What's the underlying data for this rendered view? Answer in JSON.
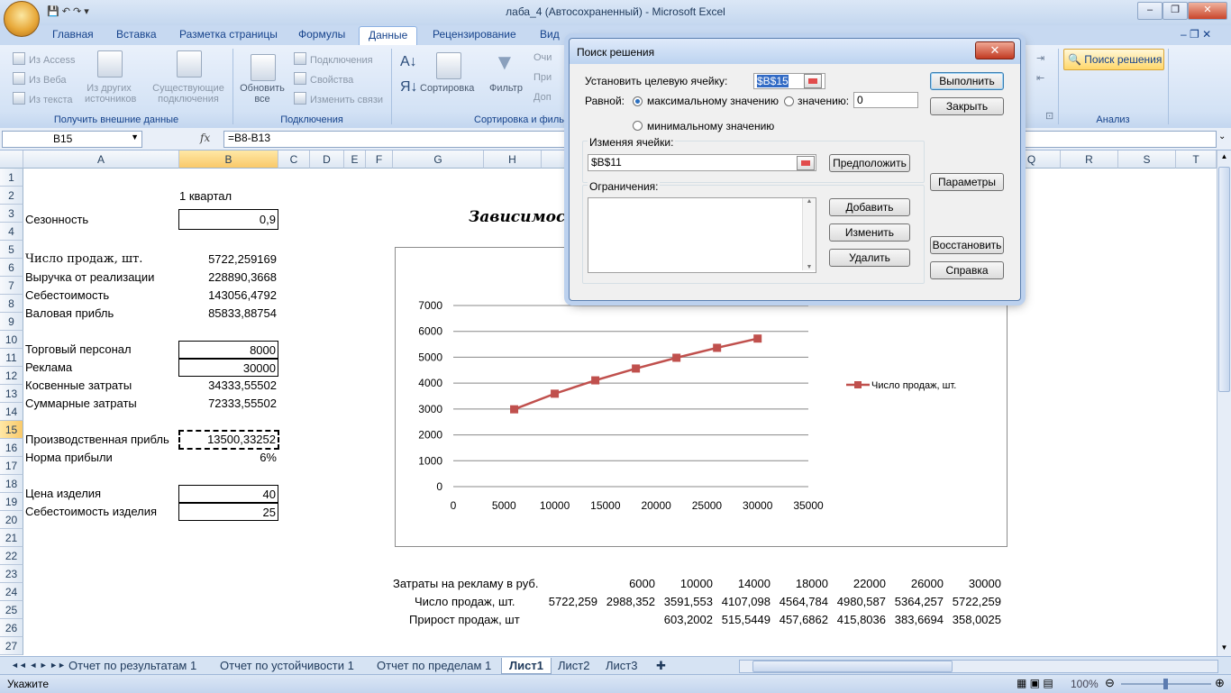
{
  "window": {
    "title": "лаба_4 (Автосохраненный) - Microsoft Excel"
  },
  "tabs": [
    "Главная",
    "Вставка",
    "Разметка страницы",
    "Формулы",
    "Данные",
    "Рецензирование",
    "Вид"
  ],
  "ribbon": {
    "get_external": {
      "access": "Из Access",
      "web": "Из Веба",
      "text": "Из текста",
      "other_l1": "Из других",
      "other_l2": "источников",
      "existing_l1": "Существующие",
      "existing_l2": "подключения",
      "label": "Получить внешние данные"
    },
    "connections": {
      "refresh_l1": "Обновить",
      "refresh_l2": "все",
      "connections": "Подключения",
      "properties": "Свойства",
      "edit_links": "Изменить связи",
      "label": "Подключения"
    },
    "sort": {
      "sort": "Сортировка",
      "filter": "Фильтр",
      "clear": "Очи",
      "reapply": "При",
      "advanced": "Доп",
      "label": "Сортировка и филь"
    },
    "analysis": {
      "solver": "Поиск решения",
      "label": "Анализ"
    }
  },
  "formula_bar": {
    "name": "B15",
    "fx": "fx",
    "formula": "=B8-B13"
  },
  "columns": [
    "A",
    "B",
    "C",
    "D",
    "E",
    "F",
    "G",
    "H",
    "Q",
    "R",
    "S",
    "T"
  ],
  "rows_numbers": [
    "1",
    "2",
    "3",
    "4",
    "5",
    "6",
    "7",
    "8",
    "9",
    "10",
    "11",
    "12",
    "13",
    "14",
    "15",
    "16",
    "17",
    "18",
    "19",
    "20",
    "21",
    "22",
    "23",
    "24",
    "25",
    "26",
    "27"
  ],
  "cells": {
    "b2": "1 квартал",
    "a3": "Сезонность",
    "b3": "0,9",
    "a5": "Число продаж, шт.",
    "b5": "5722,259169",
    "a6": "Выручка от реализации",
    "b6": "228890,3668",
    "a7": "Себестоимость",
    "b7": "143056,4792",
    "a8": "Валовая прибль",
    "b8": "85833,88754",
    "a10": "Торговый персонал",
    "b10": "8000",
    "a11": "Реклама",
    "b11": "30000",
    "a12": "Косвенные затраты",
    "b12": "34333,55502",
    "a13": "Суммарные затраты",
    "b13": "72333,55502",
    "a15": "Производственная прибль",
    "b15": "13500,33252",
    "a16": "Норма прибыли",
    "b16": "6%",
    "a18": "Цена изделия",
    "b18": "40",
    "a19": "Себестоимость изделия",
    "b19": "25"
  },
  "table": {
    "r23_label": "Затраты на рекламу в руб.",
    "r23": [
      "6000",
      "10000",
      "14000",
      "18000",
      "22000",
      "26000",
      "30000"
    ],
    "r24_label": "Число продаж, шт.",
    "r24_first": "5722,259",
    "r24": [
      "2988,352",
      "3591,553",
      "4107,098",
      "4564,784",
      "4980,587",
      "5364,257",
      "5722,259"
    ],
    "r25_label": "Прирост продаж, шт",
    "r25": [
      "603,2002",
      "515,5449",
      "457,6862",
      "415,8036",
      "383,6694",
      "358,0025"
    ]
  },
  "chart_data": {
    "type": "line",
    "title": "Зависимост",
    "x": [
      6000,
      10000,
      14000,
      18000,
      22000,
      26000,
      30000
    ],
    "series": [
      {
        "name": "Число продаж, шт.",
        "values": [
          2988.352,
          3591.553,
          4107.098,
          4564.784,
          4980.587,
          5364.257,
          5722.259
        ],
        "color": "#c0504d"
      }
    ],
    "xlim": [
      0,
      35000
    ],
    "ylim": [
      0,
      7000
    ],
    "xticks": [
      "0",
      "5000",
      "10000",
      "15000",
      "20000",
      "25000",
      "30000",
      "35000"
    ],
    "yticks": [
      "0",
      "1000",
      "2000",
      "3000",
      "4000",
      "5000",
      "6000",
      "7000"
    ],
    "grid": true,
    "legend": "right"
  },
  "sheets": [
    "Отчет по результатам 1",
    "Отчет по устойчивости 1",
    "Отчет по пределам 1",
    "Лист1",
    "Лист2",
    "Лист3"
  ],
  "status": {
    "mode": "Укажите",
    "zoom": "100%"
  },
  "dialog": {
    "title": "Поиск решения",
    "target_label": "Установить целевую ячейку:",
    "target_value": "$B$15",
    "equal_label": "Равной:",
    "max_label": "максимальному значению",
    "value_label": "значению:",
    "value_input": "0",
    "min_label": "минимальному значению",
    "changing_label": "Изменяя ячейки:",
    "changing_value": "$B$11",
    "constraints_label": "Ограничения:",
    "btn_execute": "Выполнить",
    "btn_close": "Закрыть",
    "btn_guess": "Предположить",
    "btn_params": "Параметры",
    "btn_add": "Добавить",
    "btn_change": "Изменить",
    "btn_delete": "Удалить",
    "btn_restore": "Восстановить",
    "btn_help": "Справка",
    "close_glyph": "✕"
  }
}
